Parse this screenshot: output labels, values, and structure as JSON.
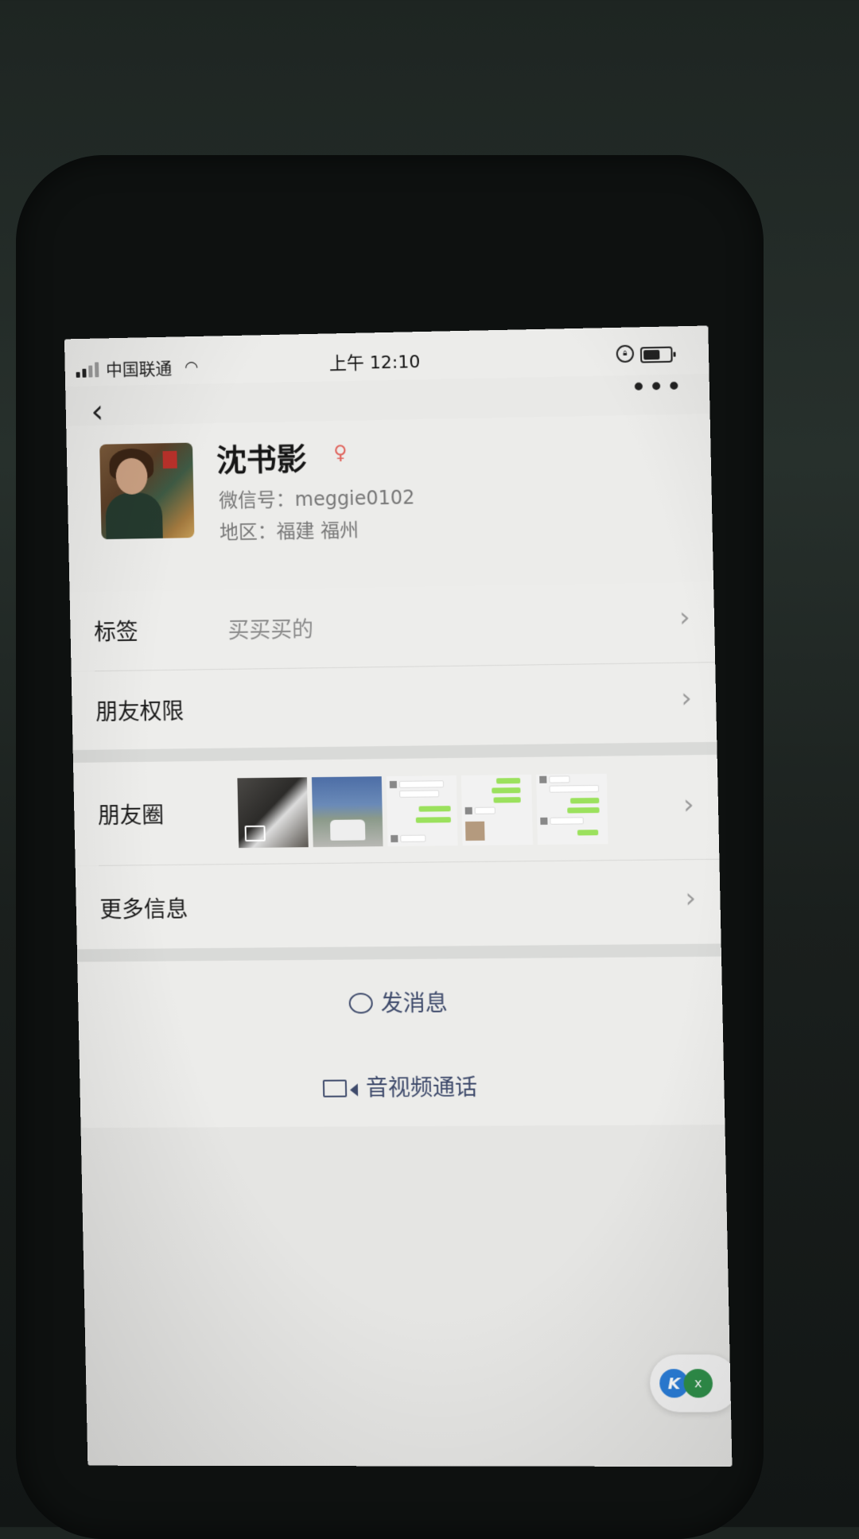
{
  "status_bar": {
    "carrier": "中国联通",
    "time": "上午 12:10"
  },
  "profile": {
    "name": "沈书影",
    "wechat_id": "微信号：meggie0102",
    "region": "地区：福建 福州"
  },
  "rows": {
    "tags_label": "标签",
    "tags_value": "买买买的",
    "friend_permissions": "朋友权限",
    "moments": "朋友圈",
    "more_info": "更多信息"
  },
  "actions": {
    "send_message": "发消息",
    "av_call": "音视频通话"
  },
  "widget": {
    "close": "x"
  },
  "colors": {
    "action_text": "#3e4a6b",
    "gender_icon": "#e0645d",
    "chat_bubble_green": "#9be15d"
  },
  "icons": [
    "back-icon",
    "more-icon",
    "gender-female-icon",
    "chevron-right-icon",
    "chat-bubble-icon",
    "video-camera-icon"
  ]
}
